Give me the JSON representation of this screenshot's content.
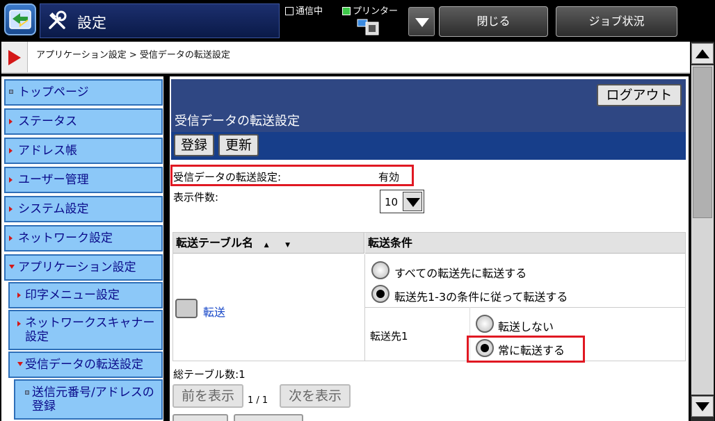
{
  "header": {
    "title": "設定",
    "comm_label": "通信中",
    "printer_label": "プリンター",
    "close_label": "閉じる",
    "job_status_label": "ジョブ状況"
  },
  "breadcrumb": "アプリケーション設定 > 受信データの転送設定",
  "sidebar": {
    "items": [
      {
        "label": "トップページ"
      },
      {
        "label": "ステータス"
      },
      {
        "label": "アドレス帳"
      },
      {
        "label": "ユーザー管理"
      },
      {
        "label": "システム設定"
      },
      {
        "label": "ネットワーク設定"
      },
      {
        "label": "アプリケーション設定"
      },
      {
        "label": "印字メニュー設定"
      },
      {
        "label": "ネットワークスキャナー設定"
      },
      {
        "label": "受信データの転送設定"
      },
      {
        "label": "送信元番号/アドレスの登録"
      }
    ]
  },
  "main": {
    "logout_label": "ログアウト",
    "page_title": "受信データの転送設定",
    "register_label": "登録",
    "update_label": "更新",
    "forward_setting_label": "受信データの転送設定:",
    "forward_setting_value": "有効",
    "display_count_label": "表示件数:",
    "display_count_value": "10",
    "table": {
      "col_name": "転送テーブル名",
      "sort_asc": "▲",
      "sort_desc": "▼",
      "col_condition": "転送条件",
      "row_name": "転送",
      "opt_all": "すべての転送先に転送する",
      "opt_cond": "転送先1-3の条件に従って転送する",
      "dest_label": "転送先1",
      "opt_no": "転送しない",
      "opt_always": "常に転送する"
    },
    "total_label": "総テーブル数:1",
    "prev_label": "前を表示",
    "page_info": "1 / 1",
    "next_label": "次を表示"
  },
  "colors": {
    "accent_red": "#e01822",
    "nav_bg": "#8cc8f8",
    "header_blue": "#2f4783"
  }
}
